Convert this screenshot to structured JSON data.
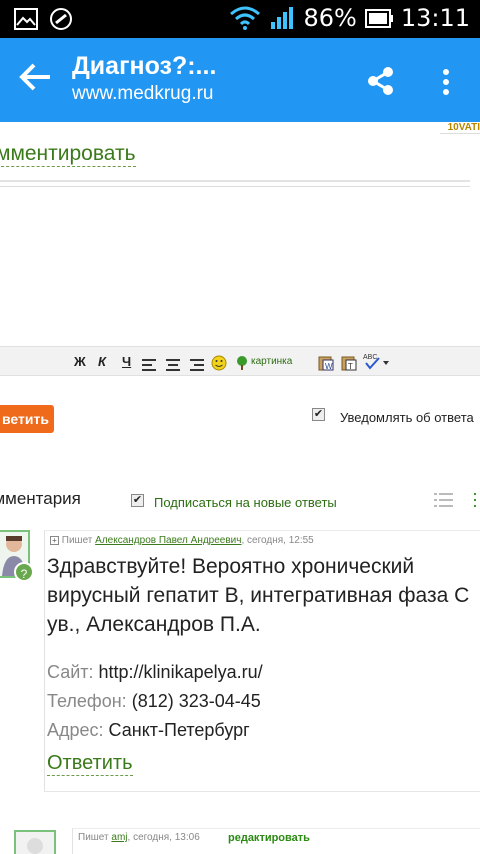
{
  "status_bar": {
    "battery": "86%",
    "time": "13:11"
  },
  "app_bar": {
    "title": "Диагноз?:...",
    "subtitle": "www.medkrug.ru"
  },
  "banner_stub": "10VATI",
  "comment_form": {
    "heading": "мментировать",
    "toolbar": {
      "bold": "Ж",
      "italic": "К",
      "underline": "Ч",
      "image_label": "картинка"
    },
    "reply_button": "ветить",
    "notify_label": "Уведомлять об ответа"
  },
  "comments_header": {
    "count_label": "омментария",
    "subscribe_label": "Подписаться на новые ответы"
  },
  "comments": [
    {
      "meta_prefix": "Пишет",
      "author": "Александров Павел Андреевич",
      "time": ", сегодня, 12:55",
      "text": "Здравствуйте! Вероятно хронический вирусный гепатит В, интегративная фаза С ув., Александров П.А.",
      "site_key": "Сайт:",
      "site_value": "http://klinikapelya.ru/",
      "phone_key": "Телефон:",
      "phone_value": "(812) 323-04-45",
      "address_key": "Адрес:",
      "address_value": "Санкт-Петербург",
      "reply_link": "Ответить"
    },
    {
      "meta_prefix": "Пишет",
      "author": "amj",
      "time": ", сегодня, 13:06",
      "edit_link": "редактировать"
    }
  ],
  "colors": {
    "appbar": "#2196f3",
    "link_green": "#3a7a1a",
    "reply_orange": "#ef6a1a"
  }
}
